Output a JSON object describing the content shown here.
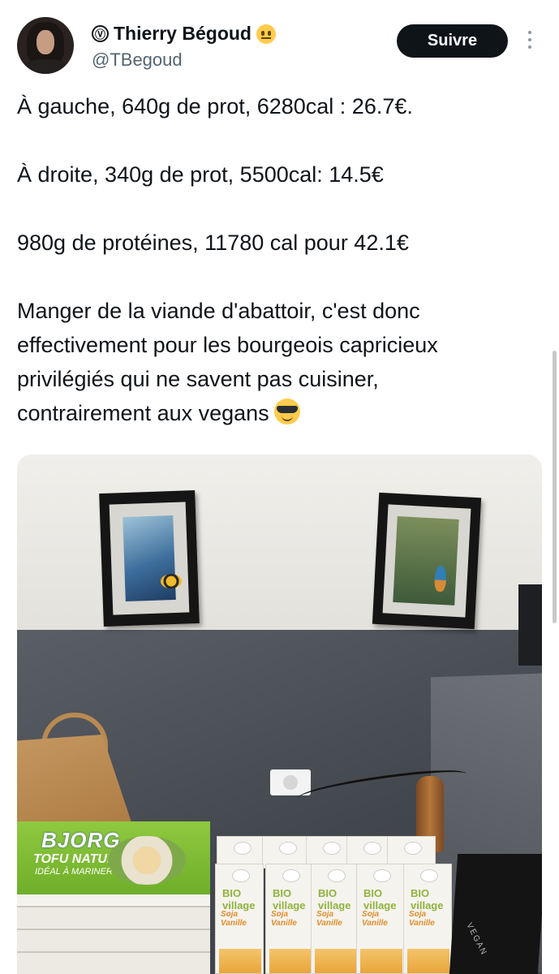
{
  "author": {
    "verified_symbol": "Ⓥ",
    "name": "Thierry Bégoud",
    "handle": "@TBegoud",
    "avatar_icon": "avatar"
  },
  "actions": {
    "follow_label": "Suivre",
    "more_icon": "more-vertical-icon"
  },
  "tweet": {
    "line1": "À gauche, 640g de prot, 6280cal : 26.7€.",
    "line2": "À droite, 340g de prot, 5500cal: 14.5€",
    "line3": "980g de protéines, 11780 cal pour 42.1€",
    "line4_a": "Manger de la viande d'abattoir, c'est donc",
    "line4_b": "effectivement pour les bourgeois capricieux",
    "line4_c": "privilégiés qui ne savent pas cuisiner,",
    "line4_d": "contrairement aux vegans"
  },
  "photo": {
    "bjorg_brand": "BJORG",
    "bjorg_product": "TOFU NATURE",
    "bjorg_sub": "IDÉAL À MARINER",
    "carton_brand": "BIO village",
    "carton_flavor": "Soja Vanille",
    "bag_text": "VEGAN"
  },
  "colors": {
    "follow_bg": "#0f1419",
    "handle": "#536471",
    "emoji_yellow": "#ffcc4d"
  }
}
